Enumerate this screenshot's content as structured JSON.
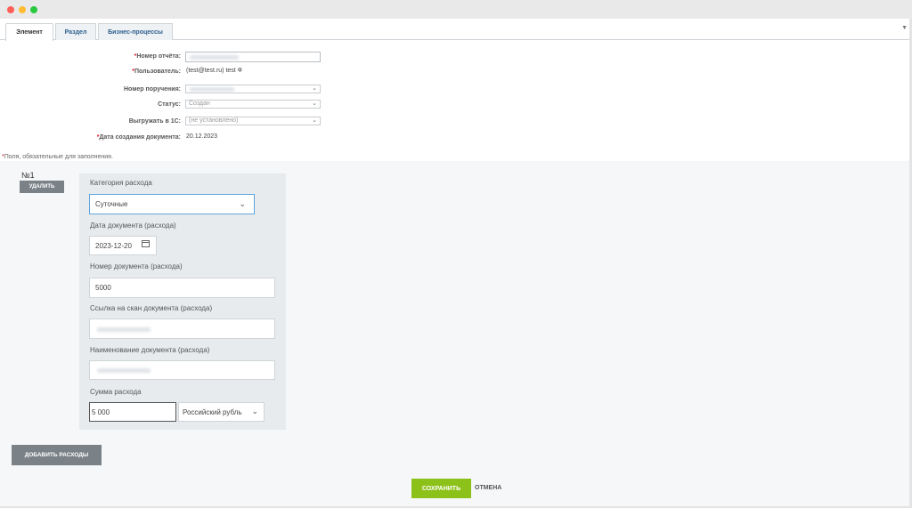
{
  "tabs": [
    {
      "label": "Элемент"
    },
    {
      "label": "Раздел"
    },
    {
      "label": "Бизнес-процессы"
    }
  ],
  "form": {
    "report_number": {
      "required_mark": "*",
      "label": "Номер отчёта:"
    },
    "user": {
      "required_mark": "*",
      "label": "Пользователь:",
      "value": "(test@test.ru) test Ф"
    },
    "order_number": {
      "label": "Номер поручения:"
    },
    "status": {
      "label": "Статус:",
      "value": "Создан"
    },
    "export_1c": {
      "label": "Выгружать в 1С:",
      "value": "(не установлено)"
    },
    "doc_date": {
      "required_mark": "*",
      "label": "Дата создания документа:",
      "value": "20.12.2023"
    }
  },
  "required_note": {
    "mark": "*",
    "text": "Поля, обязательные для заполнения."
  },
  "expense": {
    "number": "№1",
    "delete_label": "УДАЛИТЬ",
    "category": {
      "label": "Категория расхода",
      "value": "Суточные"
    },
    "date": {
      "label": "Дата документа (расхода)",
      "value": "2023-12-20"
    },
    "doc_number": {
      "label": "Номер документа (расхода)",
      "value": "5000"
    },
    "scan_link": {
      "label": "Ссылка на скан документа (расхода)"
    },
    "doc_name": {
      "label": "Наименование документа (расхода)"
    },
    "amount": {
      "label": "Сумма расхода",
      "value": "5 000",
      "currency": "Российский рубль"
    }
  },
  "add_expenses_label": "ДОБАВИТЬ РАСХОДЫ",
  "save_label": "СОХРАНИТЬ",
  "cancel_label": "ОТМЕНА",
  "colors": {
    "accent_green": "#8cc11a",
    "required_red": "#d9232e",
    "focus_blue": "#5fa4dd"
  },
  "icons": [
    "window-close-icon",
    "window-minimize-icon",
    "window-zoom-icon",
    "chevron-down-icon",
    "calendar-icon"
  ]
}
